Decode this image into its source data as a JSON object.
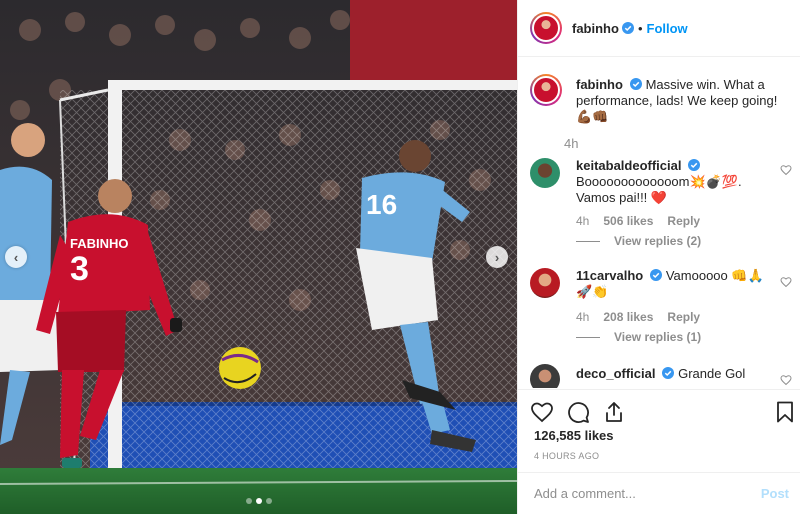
{
  "media": {
    "jersey_number_red": "3",
    "jersey_name_red": "FABINHO",
    "jersey_number_blue": "16",
    "carousel_dots": 3,
    "active_dot": 1,
    "prev_icon": "chevron-left-icon",
    "next_icon": "chevron-right-icon"
  },
  "header": {
    "username": "fabinho",
    "separator": "•",
    "follow_label": "Follow"
  },
  "caption": {
    "username": "fabinho",
    "text": "Massive win. What a performance, lads! We keep going! 💪🏾👊🏾",
    "time": "4h"
  },
  "comments": [
    {
      "username": "keitabaldeofficial",
      "text": "Booooooooooooom💥💣💯. Vamos pai!!! ❤️",
      "time": "4h",
      "likes": "506 likes",
      "reply_label": "Reply",
      "view_replies": "View replies (2)"
    },
    {
      "username": "11carvalho",
      "text": "Vamooooo 👊🙏 🚀👏",
      "time": "4h",
      "likes": "208 likes",
      "reply_label": "Reply",
      "view_replies": "View replies (1)"
    },
    {
      "username": "deco_official",
      "text": "Grande Gol",
      "time": "",
      "likes": "",
      "reply_label": "",
      "view_replies": ""
    }
  ],
  "actions": {
    "likes": "126,585 likes",
    "timestamp": "4 HOURS AGO"
  },
  "composer": {
    "placeholder": "Add a comment...",
    "post_label": "Post"
  },
  "colors": {
    "verified": "#3897f0",
    "link": "#0095f6",
    "post_disabled": "#b2dffc",
    "liverpool_red": "#c8102e",
    "city_blue": "#6cabdd"
  }
}
